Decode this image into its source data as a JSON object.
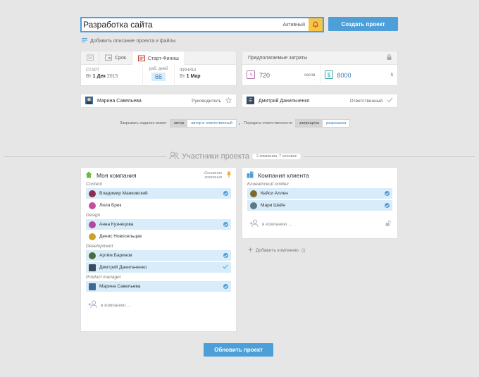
{
  "header": {
    "title_value": "Разработка сайта",
    "status": "Активный",
    "create_button": "Создать проект",
    "add_description": "Добавить описание проекта и файлы"
  },
  "dates": {
    "tabs": [
      "Срок",
      "Старт-Финиш"
    ],
    "start_label": "СТАРТ",
    "start_day": "Вт",
    "start_date": "1 Дек",
    "start_year": "2015",
    "days_label": "раб. дней",
    "days_value": "66",
    "finish_label": "ФИНИШ",
    "finish_day": "Вт",
    "finish_date": "1 Мар"
  },
  "costs": {
    "title": "Предполагаемые затраты",
    "hours_value": "720",
    "hours_unit": "часов",
    "money_value": "8000",
    "money_unit": "$"
  },
  "roles": {
    "manager_name": "Марина Савельева",
    "manager_role": "Руководитель",
    "responsible_name": "Дмитрий Данильченко",
    "responsible_role": "Ответственный"
  },
  "settings": {
    "close_label": "Закрывать задания может",
    "close_options": [
      "автор",
      "автор и ответственный"
    ],
    "transfer_label": "Передача ответственности",
    "transfer_options": [
      "запрещена",
      "разрешена"
    ]
  },
  "participants": {
    "title": "Участники проекта",
    "summary": "2 компании, 7 человек"
  },
  "my_company": {
    "title": "Моя компания",
    "main_label_1": "Основная",
    "main_label_2": "компания",
    "groups": [
      {
        "name": "Content",
        "members": [
          {
            "name": "Владимир Маяковский",
            "selected": true,
            "mark": "check"
          },
          {
            "name": "Лиля Брик",
            "selected": false,
            "mark": ""
          }
        ]
      },
      {
        "name": "Design",
        "members": [
          {
            "name": "Анна Кузнецова",
            "selected": true,
            "mark": "check"
          },
          {
            "name": "Денис Новосельцев",
            "selected": false,
            "mark": ""
          }
        ]
      },
      {
        "name": "Development",
        "members": [
          {
            "name": "Артём Баринов",
            "selected": true,
            "mark": "check"
          },
          {
            "name": "Дмитрий Данильченко",
            "selected": true,
            "mark": "tick"
          }
        ]
      },
      {
        "name": "Product manager",
        "members": [
          {
            "name": "Марина Савельева",
            "selected": true,
            "mark": "check"
          }
        ]
      }
    ],
    "add_in": "в компанию ..."
  },
  "client_company": {
    "title": "Компания клиента",
    "groups": [
      {
        "name": "Клиентский отдел",
        "members": [
          {
            "name": "Кейси Аллен",
            "selected": true,
            "mark": "check"
          },
          {
            "name": "Мари Шейн",
            "selected": true,
            "mark": "check"
          }
        ]
      }
    ],
    "add_in": "в компанию ..."
  },
  "add_company_label": "Добавить компанию",
  "add_company_count": "(i)",
  "update_button": "Обновить проект",
  "colors": {
    "accent": "#4c9fd9",
    "highlight": "#d8ecf9",
    "bell": "#f7c744",
    "home": "#6cb84a"
  }
}
